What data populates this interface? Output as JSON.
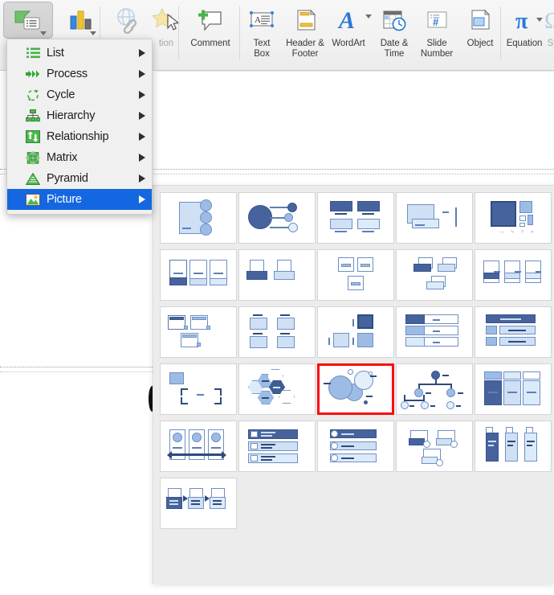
{
  "ribbon": {
    "items": [
      {
        "label": "",
        "icon": "smartart-icon",
        "name": "smartart-button",
        "selected": true,
        "has_caret": true
      },
      {
        "label": "",
        "icon": "chart-icon",
        "name": "chart-button",
        "has_caret": true
      },
      {
        "label": "",
        "icon": "hyperlink-globe-icon",
        "name": "hyperlink-button",
        "dim": true
      },
      {
        "label": "tion",
        "icon": "star-action-icon",
        "name": "action-button",
        "dim": true
      },
      {
        "label": "Comment",
        "icon": "comment-plus-icon",
        "name": "comment-button"
      },
      {
        "label": "Text\nBox",
        "icon": "text-box-icon",
        "name": "text-box-button"
      },
      {
        "label": "Header &\nFooter",
        "icon": "header-footer-icon",
        "name": "header-footer-button"
      },
      {
        "label": "WordArt",
        "icon": "wordart-a-icon",
        "name": "wordart-button",
        "has_caret": true
      },
      {
        "label": "Date &\nTime",
        "icon": "date-time-icon",
        "name": "date-time-button"
      },
      {
        "label": "Slide\nNumber",
        "icon": "slide-number-icon",
        "name": "slide-number-button"
      },
      {
        "label": "Object",
        "icon": "object-icon",
        "name": "object-button"
      },
      {
        "label": "Equation",
        "icon": "equation-pi-icon",
        "name": "equation-button",
        "has_caret": true
      },
      {
        "label": "Sym",
        "icon": "symbol-icon",
        "name": "symbol-button",
        "dim": true
      }
    ]
  },
  "smartart_menu": {
    "items": [
      {
        "label": "List",
        "icon": "list-icon",
        "selected": false
      },
      {
        "label": "Process",
        "icon": "process-icon",
        "selected": false
      },
      {
        "label": "Cycle",
        "icon": "cycle-icon",
        "selected": false
      },
      {
        "label": "Hierarchy",
        "icon": "hierarchy-icon",
        "selected": false
      },
      {
        "label": "Relationship",
        "icon": "relationship-icon",
        "selected": false
      },
      {
        "label": "Matrix",
        "icon": "matrix-icon",
        "selected": false
      },
      {
        "label": "Pyramid",
        "icon": "pyramid-icon",
        "selected": false
      },
      {
        "label": "Picture",
        "icon": "picture-icon",
        "selected": true
      }
    ],
    "selected_index": 7,
    "highlight_color": "#1467e0"
  },
  "gallery": {
    "category": "Picture",
    "selected_index": 17,
    "selection_color": "#fb0d0d",
    "columns": 5,
    "items": [
      {
        "name": "accented-picture",
        "thumb": "t1"
      },
      {
        "name": "bending-picture-accent-list",
        "thumb": "t2"
      },
      {
        "name": "bubble-picture-list",
        "thumb": "t3"
      },
      {
        "name": "captioned-pictures",
        "thumb": "t4"
      },
      {
        "name": "circular-picture-callout",
        "thumb": "t5"
      },
      {
        "name": "continuous-picture-list",
        "thumb": "t6"
      },
      {
        "name": "descending-picture-blocks",
        "thumb": "t7"
      },
      {
        "name": "framed-text-picture",
        "thumb": "t8"
      },
      {
        "name": "hexagon-cluster",
        "thumb": "t9"
      },
      {
        "name": "picture-accent-blocks",
        "thumb": "t10"
      },
      {
        "name": "picture-accent-list",
        "thumb": "t11"
      },
      {
        "name": "picture-caption-list",
        "thumb": "t12"
      },
      {
        "name": "picture-grid",
        "thumb": "t13"
      },
      {
        "name": "picture-lineup",
        "thumb": "t14"
      },
      {
        "name": "picture-strips",
        "thumb": "t15"
      },
      {
        "name": "radial-picture-list",
        "thumb": "t16"
      },
      {
        "name": "snapshot-picture-list",
        "thumb": "t17"
      },
      {
        "name": "spiral-picture",
        "thumb": "t18"
      },
      {
        "name": "alternating-picture-circles",
        "thumb": "t19"
      },
      {
        "name": "title-picture-lineup",
        "thumb": "t20"
      },
      {
        "name": "vertical-picture-accent-list",
        "thumb": "t21"
      },
      {
        "name": "vertical-picture-list",
        "thumb": "t22"
      },
      {
        "name": "bubble-picture-accent",
        "thumb": "t23"
      },
      {
        "name": "picture-organization-chart",
        "thumb": "t24"
      },
      {
        "name": "theme-picture-alternating",
        "thumb": "t25"
      },
      {
        "name": "theme-picture-grid",
        "thumb": "t26"
      },
      {
        "name": "titled-picture-blocks",
        "thumb": "t27"
      },
      {
        "name": "titled-picture-accent-list",
        "thumb": "t28"
      },
      {
        "name": "vertical-picture-strips",
        "thumb": "t29"
      },
      {
        "name": "picture-frame-list",
        "thumb": "t30"
      },
      {
        "name": "sequential-picture-process",
        "thumb": "t31"
      }
    ]
  }
}
